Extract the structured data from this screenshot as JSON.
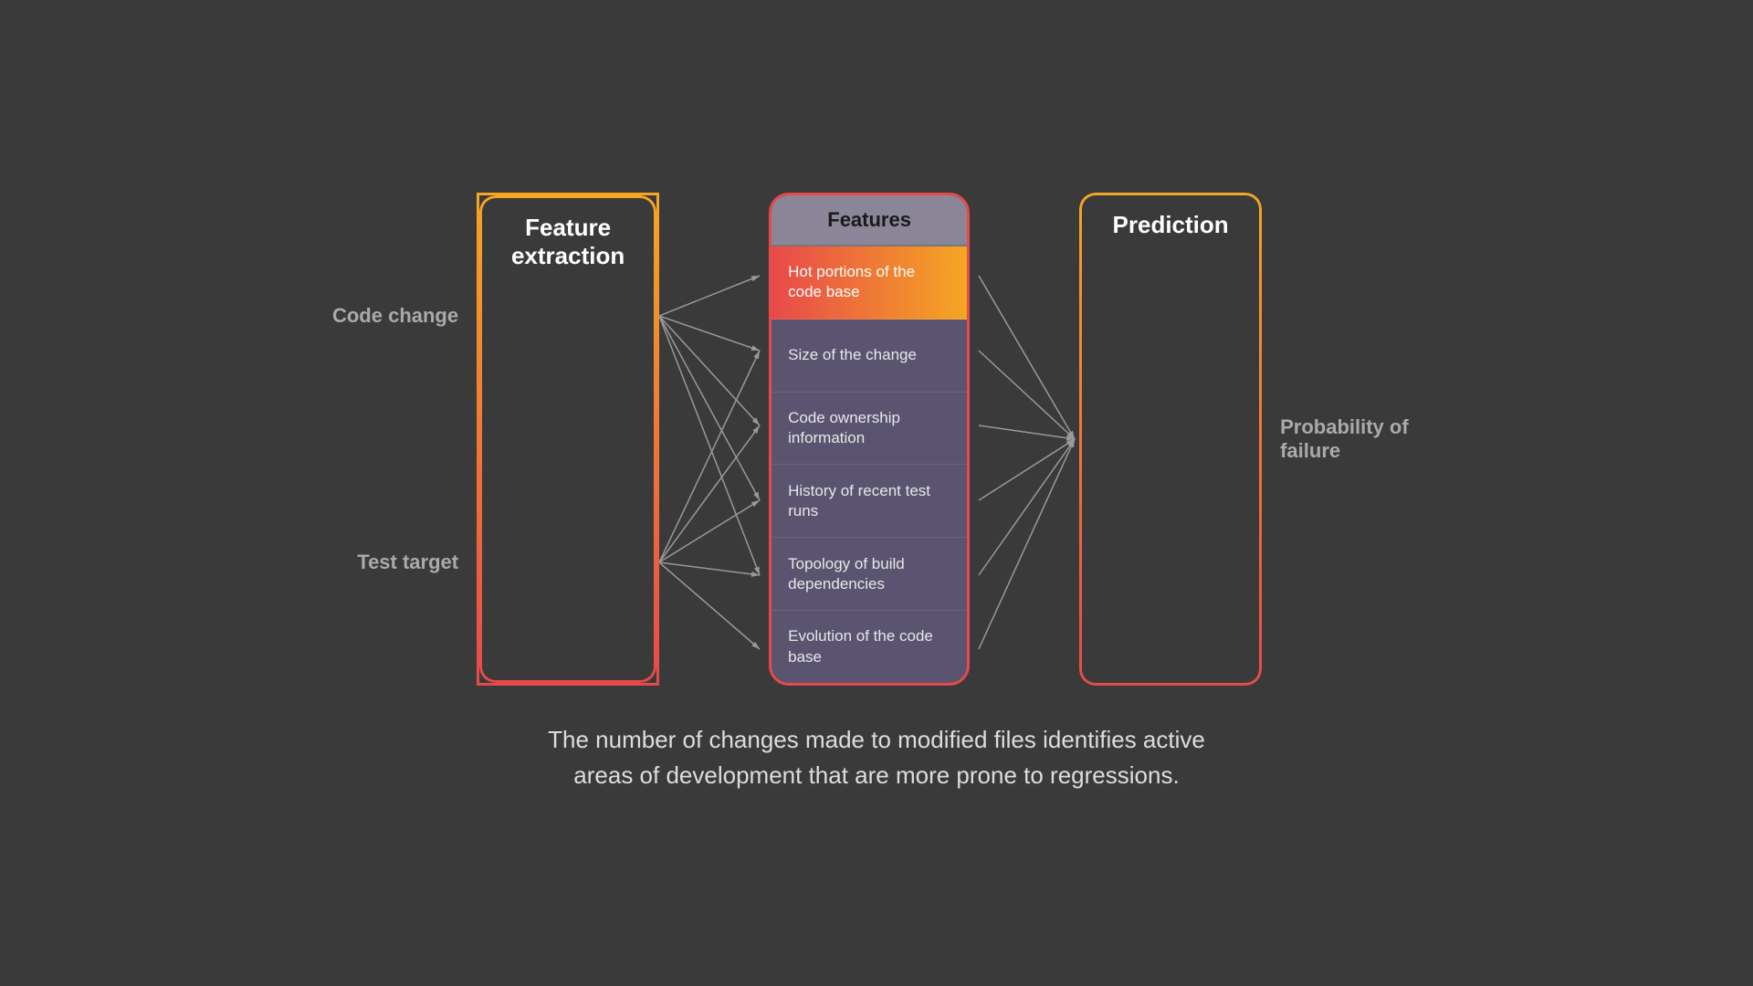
{
  "diagram": {
    "left_labels": {
      "label1": "Code change",
      "label2": "Test target"
    },
    "feature_extraction": {
      "title": "Feature\nextraction"
    },
    "features": {
      "header": "Features",
      "items": [
        {
          "text": "Hot portions of the code base",
          "highlighted": true
        },
        {
          "text": "Size of the change",
          "highlighted": false
        },
        {
          "text": "Code ownership information",
          "highlighted": false
        },
        {
          "text": "History of recent test runs",
          "highlighted": false
        },
        {
          "text": "Topology of build dependencies",
          "highlighted": false
        },
        {
          "text": "Evolution of the code base",
          "highlighted": false
        }
      ]
    },
    "prediction": {
      "title": "Prediction"
    },
    "right_label": "Probability of failure"
  },
  "caption": "The number of changes made to modified files identifies active\nareas of development that are more prone to regressions."
}
